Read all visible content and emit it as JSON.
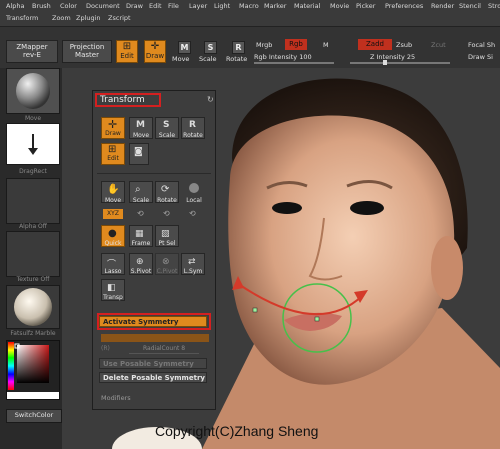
{
  "menu": [
    "Alpha",
    "Brush",
    "Color",
    "Document",
    "Draw",
    "Edit",
    "File",
    "Layer",
    "Light",
    "Macro",
    "Marker",
    "Material",
    "Movie",
    "Picker",
    "Preferences",
    "Render",
    "Stencil",
    "Stroke",
    "Transform",
    "Zoom",
    "Zplugin",
    "Zscript"
  ],
  "toolbar": {
    "zmapper_line1": "ZMapper",
    "zmapper_line2": "rev-E",
    "projection_line1": "Projection",
    "projection_line2": "Master",
    "edit": "Edit",
    "draw": "Draw",
    "move": "Move",
    "scale": "Scale",
    "rotate": "Rotate",
    "mrgb": "Mrgb",
    "rgb": "Rgb",
    "m": "M",
    "rgb_intensity": "Rgb Intensity 100",
    "zadd": "Zadd",
    "zsub": "Zsub",
    "zcut": "Zcut",
    "z_intensity": "Z Intensity 25",
    "focal_shift": "Focal Sh",
    "draw_size": "Draw Si"
  },
  "left_tray": {
    "move": "Move",
    "dragrect": "DragRect",
    "alpha_off": "Alpha Off",
    "texture_off": "Texture Off",
    "material": "Fatsulfz Marble",
    "switch_color": "SwitchColor"
  },
  "palette": {
    "title": "Transform",
    "draw": "Draw",
    "move": "Move",
    "scale": "Scale",
    "rotate": "Rotate",
    "edit": "Edit",
    "move2": "Move",
    "scale2": "Scale",
    "rotate2": "Rotate",
    "local": "Local",
    "xyz": "XYZ",
    "quick": "Quick",
    "frame": "Frame",
    "ptsel": "Pt Sel",
    "lasso": "Lasso",
    "spivot": "S.Pivot",
    "cpivot": "C.Pivot",
    "lsym": "L.Sym",
    "transp": "Transp",
    "activate_symmetry": "Activate Symmetry",
    "r": "(R)",
    "radial_count": "RadialCount 8",
    "use_posable": "Use Posable Symmetry",
    "delete_posable": "Delete Posable Symmetry",
    "modifiers": "Modifiers"
  },
  "copyright": "Copyright(C)Zhang Sheng",
  "colors": {
    "accent": "#e08a1e",
    "highlight": "#d42020",
    "bg": "#2b2b2b"
  }
}
